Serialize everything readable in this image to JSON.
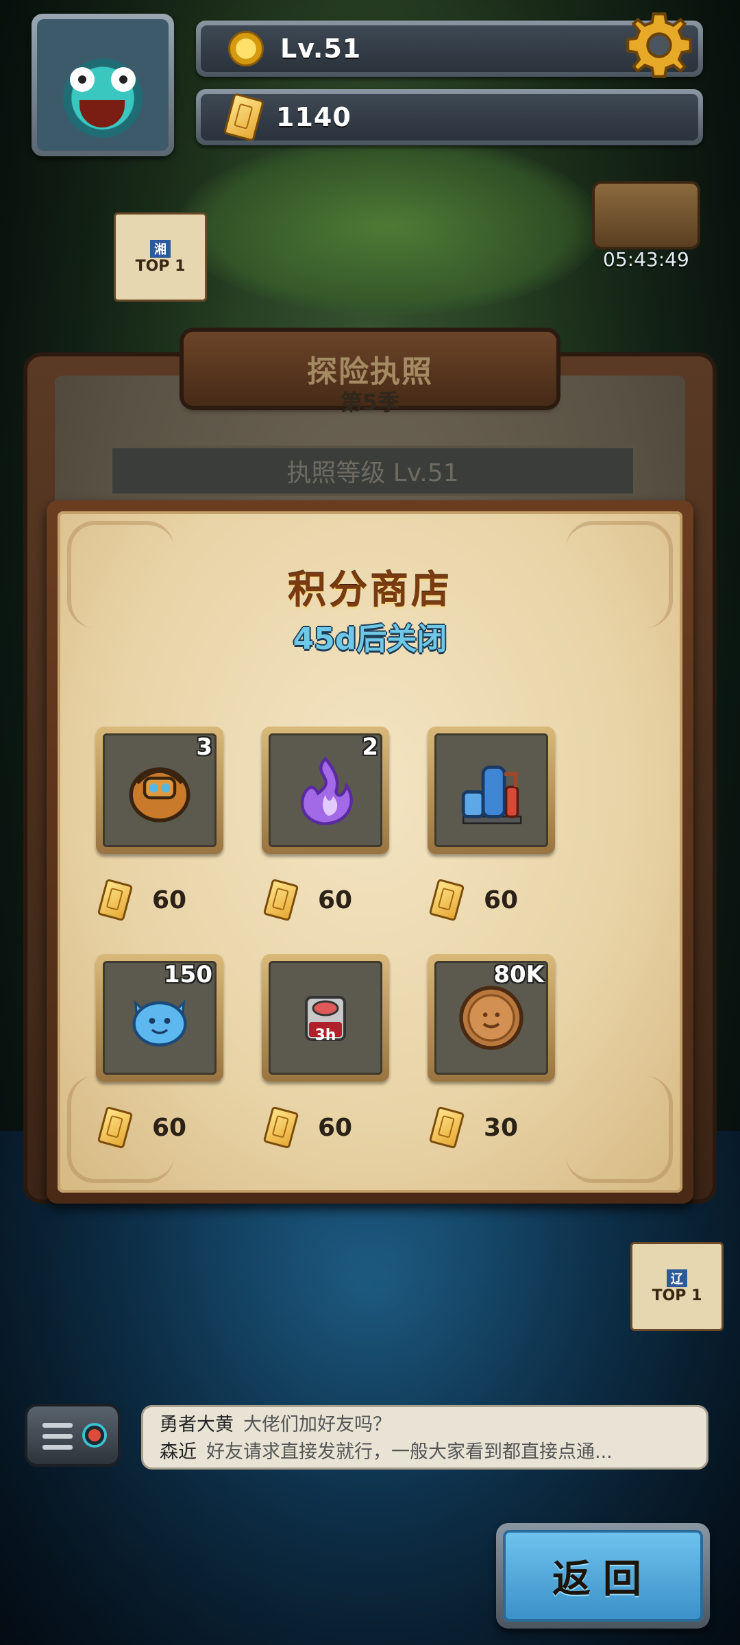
{
  "header": {
    "level_label": "Lv.51",
    "currency_value": "1140"
  },
  "map": {
    "badge_top_left": "TOP 1",
    "badge_top_left_tag": "湘",
    "badge_right": "TOP 1",
    "badge_right_tag": "辽",
    "timer": "05:43:49"
  },
  "license": {
    "title": "探险执照",
    "season": "第5季",
    "level_text": "执照等级 Lv.51"
  },
  "shop": {
    "title": "积分商店",
    "subtitle": "45d后关闭",
    "items": [
      {
        "icon": "backpack-icon",
        "qty": "3",
        "price": "60"
      },
      {
        "icon": "purple-flame-icon",
        "qty": "2",
        "price": "60"
      },
      {
        "icon": "water-tank-machine-icon",
        "qty": "",
        "price": "60"
      },
      {
        "icon": "blue-slime-icon",
        "qty": "150",
        "price": "60"
      },
      {
        "icon": "time-boost-3h-icon",
        "qty": "",
        "price": "60",
        "badge": "3h"
      },
      {
        "icon": "bronze-coin-icon",
        "qty": "80K",
        "price": "30"
      }
    ]
  },
  "chat": {
    "messages": [
      {
        "name": "勇者大黄",
        "text": "大佬们加好友吗？"
      },
      {
        "name": "森近",
        "text": "好友请求直接发就行，一般大家看到都直接点通..."
      }
    ]
  },
  "back_button": "返回",
  "colors": {
    "shop_title": "#7a3b10",
    "subtitle": "#6ec8e6",
    "back_button": "#4aa3d8"
  }
}
